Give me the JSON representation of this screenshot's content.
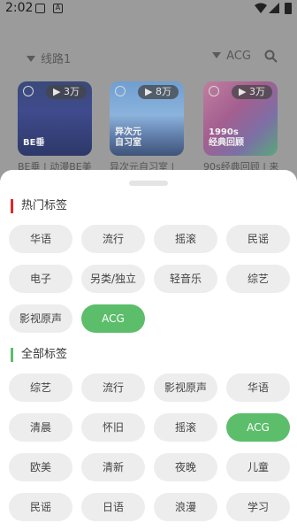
{
  "status_bar": {
    "time": "2:02"
  },
  "filters": {
    "route_label": "线路1",
    "category_label": "ACG"
  },
  "cards": [
    {
      "plays": "3万",
      "cover_text": "BE垂",
      "title": "BE垂 | 动漫BE美"
    },
    {
      "plays": "8万",
      "cover_text": "异次元\n自习室",
      "title": "异次元自习室 |"
    },
    {
      "plays": "3万",
      "cover_text": "1990s\n经典回顾",
      "title": "90s经典回顾 | 来"
    }
  ],
  "sheet": {
    "hot_title": "热门标签",
    "hot_tags": [
      "华语",
      "流行",
      "摇滚",
      "民谣",
      "电子",
      "另类/独立",
      "轻音乐",
      "综艺",
      "影视原声",
      "ACG"
    ],
    "hot_active": "ACG",
    "all_title": "全部标签",
    "all_tags": [
      "综艺",
      "流行",
      "影视原声",
      "华语",
      "清晨",
      "怀旧",
      "摇滚",
      "ACG",
      "欧美",
      "清新",
      "夜晚",
      "儿童",
      "民谣",
      "日语",
      "浪漫",
      "学习"
    ],
    "all_active": "ACG"
  },
  "colors": {
    "hot_bar": "#e0262a",
    "all_bar": "#5cbd6b",
    "active_chip": "#5cbd6b",
    "chip": "#ededed",
    "scrim": "#9b9b9b"
  },
  "icons": [
    "image-icon",
    "a-icon",
    "wifi-icon",
    "cellular-icon",
    "battery-icon",
    "dropdown-triangle-icon",
    "search-icon",
    "netease-logo-icon"
  ]
}
